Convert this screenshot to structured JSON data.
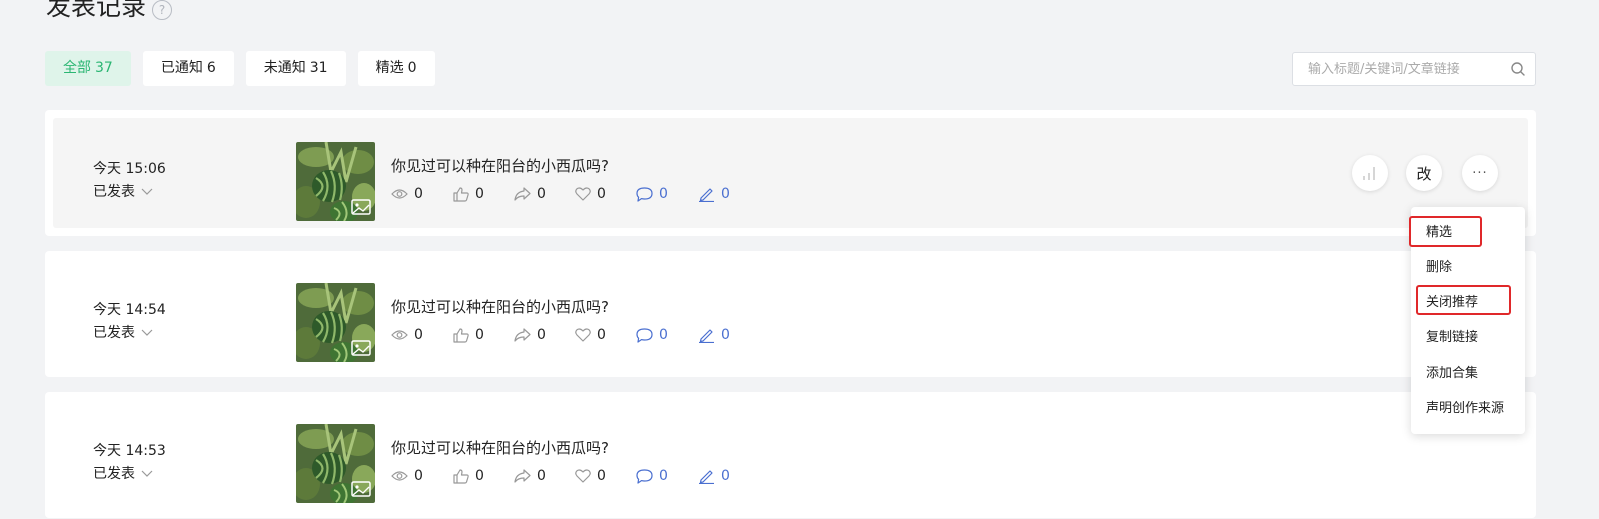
{
  "page": {
    "title": "发表记录",
    "help_icon": "?"
  },
  "filters": [
    {
      "label": "全部",
      "count": "37",
      "active": true
    },
    {
      "label": "已通知",
      "count": "6",
      "active": false
    },
    {
      "label": "未通知",
      "count": "31",
      "active": false
    },
    {
      "label": "精选",
      "count": "0",
      "active": false
    }
  ],
  "search": {
    "placeholder": "输入标题/关键词/文章链接",
    "icon": "search-icon"
  },
  "articles": [
    {
      "time": "今天 15:06",
      "status": "已发表",
      "title": "你见过可以种在阳台的小西瓜吗?",
      "views": "0",
      "likes": "0",
      "shares": "0",
      "favorites": "0",
      "comments": "0",
      "edits": "0"
    },
    {
      "time": "今天 14:54",
      "status": "已发表",
      "title": "你见过可以种在阳台的小西瓜吗?",
      "views": "0",
      "likes": "0",
      "shares": "0",
      "favorites": "0",
      "comments": "0",
      "edits": "0"
    },
    {
      "time": "今天 14:53",
      "status": "已发表",
      "title": "你见过可以种在阳台的小西瓜吗?",
      "views": "0",
      "likes": "0",
      "shares": "0",
      "favorites": "0",
      "comments": "0",
      "edits": "0"
    }
  ],
  "actions": {
    "stats_icon": "bar-chart-icon",
    "edit_label": "改",
    "more_label": "···"
  },
  "more_menu": {
    "items": [
      "精选",
      "删除",
      "关闭推荐",
      "复制链接",
      "添加合集",
      "声明创作来源"
    ],
    "highlighted": [
      "精选",
      "关闭推荐"
    ]
  },
  "colors": {
    "accent_green": "#2bb673",
    "active_tab_bg": "#dff4ea",
    "highlight_red": "#e0282a",
    "stat_blue": "#4a6fd0"
  }
}
